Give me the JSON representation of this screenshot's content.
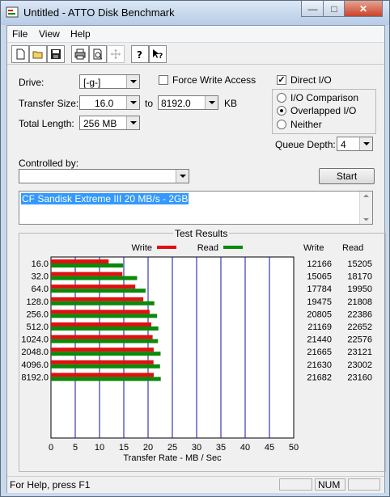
{
  "window": {
    "title": "Untitled - ATTO Disk Benchmark"
  },
  "menu": {
    "file": "File",
    "view": "View",
    "help": "Help"
  },
  "toolbar": {
    "icons": [
      "new-icon",
      "open-icon",
      "save-icon",
      "print-icon",
      "print-preview-icon",
      "move-icon",
      "help-icon",
      "context-help-icon"
    ]
  },
  "form": {
    "drive_label": "Drive:",
    "drive_value": "[-g-]",
    "force_write_label": "Force Write Access",
    "direct_io_label": "Direct I/O",
    "transfer_size_label": "Transfer Size:",
    "transfer_from": "16.0",
    "to_label": "to",
    "transfer_to": "8192.0",
    "kb_label": "KB",
    "total_length_label": "Total Length:",
    "total_length_value": "256 MB",
    "io_comparison_label": "I/O Comparison",
    "overlapped_io_label": "Overlapped I/O",
    "neither_label": "Neither",
    "queue_depth_label": "Queue Depth:",
    "queue_depth_value": "4",
    "controlled_by_label": "Controlled by:",
    "controlled_by_value": "",
    "start_label": "Start",
    "description": "CF Sandisk Extreme III 20 MB/s - 2GB"
  },
  "results": {
    "title": "Test Results",
    "write_legend": "Write",
    "read_legend": "Read",
    "write_header": "Write",
    "read_header": "Read",
    "xlabel": "Transfer Rate - MB / Sec"
  },
  "chart_data": {
    "type": "bar",
    "orientation": "horizontal",
    "categories": [
      "16.0",
      "32.0",
      "64.0",
      "128.0",
      "256.0",
      "512.0",
      "1024.0",
      "2048.0",
      "4096.0",
      "8192.0"
    ],
    "series": [
      {
        "name": "Write",
        "color": "#e01010",
        "values": [
          12166,
          15065,
          17784,
          19475,
          20805,
          21169,
          21440,
          21665,
          21630,
          21682
        ]
      },
      {
        "name": "Read",
        "color": "#0a8a0a",
        "values": [
          15205,
          18170,
          19950,
          21808,
          22386,
          22652,
          22576,
          23121,
          23002,
          23160
        ]
      }
    ],
    "xlim": [
      0,
      50
    ],
    "xticks": [
      "0",
      "5",
      "10",
      "15",
      "20",
      "25",
      "30",
      "35",
      "40",
      "45",
      "50"
    ],
    "xlabel": "Transfer Rate - MB / Sec",
    "grid": true
  },
  "status": {
    "text": "For Help, press F1",
    "num": "NUM"
  }
}
